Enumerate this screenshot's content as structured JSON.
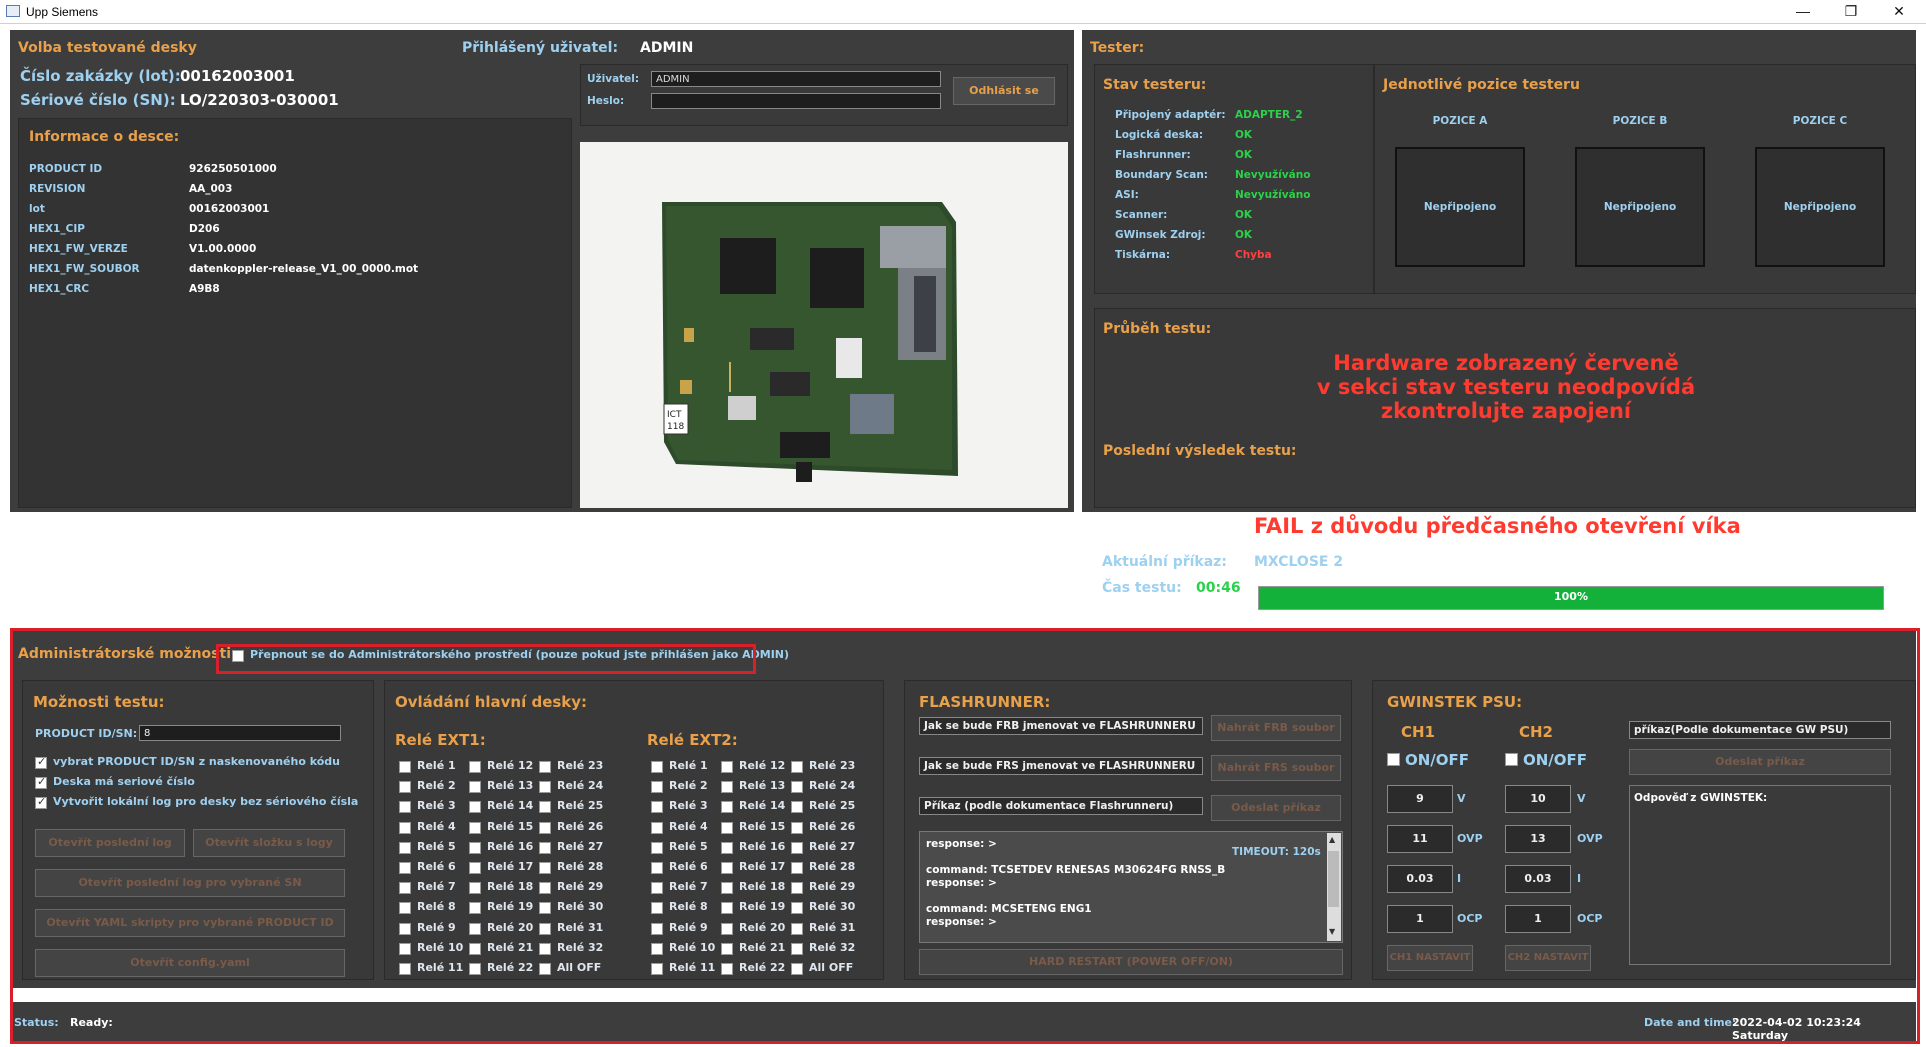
{
  "window": {
    "title": "Upp Siemens"
  },
  "left": {
    "header": "Volba testované desky",
    "lot_label": "Číslo zakázky (lot):",
    "lot_value": "00162003001",
    "sn_label": "Sériové číslo (SN):",
    "sn_value": "LO/220303-030001",
    "info_title": "Informace o desce:",
    "info_rows": [
      {
        "k": "PRODUCT ID",
        "v": "926250501000"
      },
      {
        "k": "REVISION",
        "v": "AA_003"
      },
      {
        "k": "lot",
        "v": "00162003001"
      },
      {
        "k": "HEX1_CIP",
        "v": "D206"
      },
      {
        "k": "HEX1_FW_VERZE",
        "v": "V1.00.0000"
      },
      {
        "k": "HEX1_FW_SOUBOR",
        "v": "datenkoppler-release_V1_00_0000.mot"
      },
      {
        "k": "HEX1_CRC",
        "v": "A9B8"
      }
    ]
  },
  "user": {
    "logged_label": "Přihlášený uživatel:",
    "logged_value": "ADMIN",
    "user_label": "Uživatel:",
    "user_value": "ADMIN",
    "pass_label": "Heslo:",
    "pass_value": "",
    "logout_button": "Odhlásit se"
  },
  "photo": {
    "badge_line1": "ICT",
    "badge_line2": "118"
  },
  "tester": {
    "header": "Tester:",
    "status_title": "Stav testeru:",
    "status_rows": [
      {
        "k": "Připojený adaptér:",
        "v": "ADAPTER_2",
        "c": "#2bd14a"
      },
      {
        "k": "Logická deska:",
        "v": "OK",
        "c": "#2bd14a"
      },
      {
        "k": "Flashrunner:",
        "v": "OK",
        "c": "#2bd14a"
      },
      {
        "k": "Boundary Scan:",
        "v": "Nevyužíváno",
        "c": "#2bd14a"
      },
      {
        "k": "ASI:",
        "v": "Nevyužíváno",
        "c": "#2bd14a"
      },
      {
        "k": "Scanner:",
        "v": "OK",
        "c": "#2bd14a"
      },
      {
        "k": "GWinsek Zdroj:",
        "v": "OK",
        "c": "#2bd14a"
      },
      {
        "k": "Tiskárna:",
        "v": "Chyba",
        "c": "#ff4040"
      }
    ],
    "positions_title": "Jednotlivé pozice testeru",
    "positions": [
      {
        "label": "POZICE A",
        "state": "Nepřipojeno"
      },
      {
        "label": "POZICE B",
        "state": "Nepřipojeno"
      },
      {
        "label": "POZICE C",
        "state": "Nepřipojeno"
      }
    ],
    "progress_title": "Průběh testu:",
    "warning_lines": [
      "Hardware zobrazený červeně",
      "v sekci stav testeru neodpovídá",
      "zkontrolujte zapojení"
    ],
    "last_result_label": "Poslední výsledek testu:",
    "last_result": "FAIL z důvodu předčasného otevření víka",
    "current_cmd_label": "Aktuální příkaz:",
    "current_cmd": "MXCLOSE 2",
    "time_label": "Čas testu:",
    "time_value": "00:46",
    "progress_pct": 100,
    "progress_text": "100%",
    "colors": {
      "warn": "#ff3b30",
      "ok": "#2bd14a",
      "progress": "#13b13a"
    }
  },
  "admin": {
    "title": "Administrátorské možnosti",
    "switch_label": "Přepnout se do Administrátorského prostředí (pouze pokud jste přihlášen jako ADMIN)",
    "test_options": {
      "title": "Možnosti testu:",
      "pid_label": "PRODUCT ID/SN:",
      "pid_value": "8",
      "checks": [
        "vybrat PRODUCT ID/SN z naskenovaného kódu",
        "Deska má seriové číslo",
        "Vytvořit lokální log pro desky bez sériového čísla"
      ],
      "btn_last_log": "Otevřít poslední log",
      "btn_log_folder": "Otevřít složku s logy",
      "btn_last_log_sn": "Otevřít poslední log pro vybrané SN",
      "btn_yaml": "Otevřít YAML skripty pro vybrané PRODUCT ID",
      "btn_config": "Otevřít config.yaml"
    },
    "board": {
      "title": "Ovládání hlavní desky:",
      "ext1": "Relé EXT1:",
      "ext2": "Relé EXT2:",
      "relays_col1": [
        "Relé 1",
        "Relé 2",
        "Relé 3",
        "Relé 4",
        "Relé 5",
        "Relé 6",
        "Relé 7",
        "Relé 8",
        "Relé 9",
        "Relé 10",
        "Relé 11"
      ],
      "relays_col2": [
        "Relé 12",
        "Relé 13",
        "Relé 14",
        "Relé 15",
        "Relé 16",
        "Relé 17",
        "Relé 18",
        "Relé 19",
        "Relé 20",
        "Relé 21",
        "Relé 22"
      ],
      "relays_col3": [
        "Relé 23",
        "Relé 24",
        "Relé 25",
        "Relé 26",
        "Relé 27",
        "Relé 28",
        "Relé 29",
        "Relé 30",
        "Relé 31",
        "Relé 32",
        "All OFF"
      ]
    },
    "flash": {
      "title": "FLASHRUNNER:",
      "frb_field": "Jak se bude FRB jmenovat ve FLASHRUNNERU",
      "frb_btn": "Nahrát FRB soubor",
      "frs_field": "Jak se bude FRS jmenovat ve FLASHRUNNERU",
      "frs_btn": "Nahrát FRS soubor",
      "cmd_field": "Příkaz (podle dokumentace Flashrunneru)",
      "send_btn": "Odeslat příkaz",
      "timeout": "TIMEOUT: 120s",
      "log_lines": [
        "response: >",
        "",
        "command: TCSETDEV RENESAS M30624FG RNSS_B",
        "response: >",
        "",
        "command: MCSETENG ENG1",
        "response: >"
      ],
      "restart_btn": "HARD RESTART (POWER OFF/ON)"
    },
    "psu": {
      "title": "GWINSTEK PSU:",
      "ch1": "CH1",
      "ch2": "CH2",
      "onoff": "ON/OFF",
      "ch1_vals": [
        "9",
        "11",
        "0.03",
        "1"
      ],
      "ch2_vals": [
        "10",
        "13",
        "0.03",
        "1"
      ],
      "units": [
        "V",
        "OVP",
        "I",
        "OCP"
      ],
      "cmd_field": "příkaz(Podle dokumentace GW PSU)",
      "send_btn": "Odeslat příkaz",
      "response_label": "Odpověď z GWINSTEK:",
      "ch1_set": "CH1 NASTAVIT",
      "ch2_set": "CH2 NASTAVIT"
    }
  },
  "status": {
    "label": "Status:",
    "value": "Ready:",
    "dt_label": "Date and time:",
    "dt_value": "2022-04-02 10:23:24 Saturday"
  }
}
